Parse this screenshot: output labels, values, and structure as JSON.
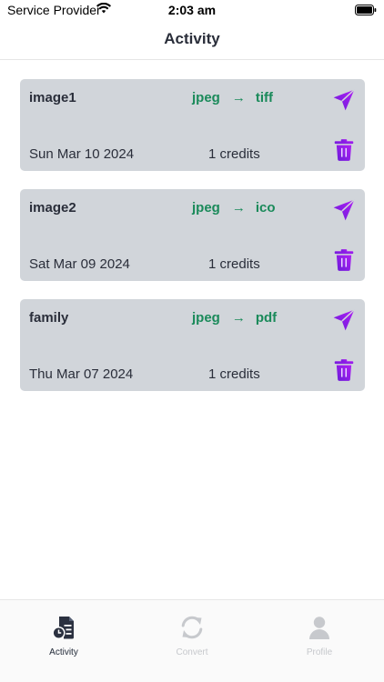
{
  "status_bar": {
    "carrier": "Service Provider",
    "time": "2:03 am"
  },
  "header": {
    "title": "Activity"
  },
  "activity": [
    {
      "name": "image1",
      "from": "jpeg",
      "arrow": "→",
      "to": "tiff",
      "date": "Sun Mar 10 2024",
      "credits": "1 credits"
    },
    {
      "name": "image2",
      "from": "jpeg",
      "arrow": "→",
      "to": "ico",
      "date": "Sat Mar 09 2024",
      "credits": "1 credits"
    },
    {
      "name": "family",
      "from": "jpeg",
      "arrow": "→",
      "to": "pdf",
      "date": "Thu Mar 07 2024",
      "credits": "1 credits"
    }
  ],
  "tabs": [
    {
      "label": "Activity",
      "icon": "activity-icon",
      "active": true
    },
    {
      "label": "Convert",
      "icon": "convert-icon",
      "active": false
    },
    {
      "label": "Profile",
      "icon": "profile-icon",
      "active": false
    }
  ],
  "colors": {
    "accent": "#8b14f0",
    "format": "#1a8a5a",
    "card": "#d1d5da"
  }
}
